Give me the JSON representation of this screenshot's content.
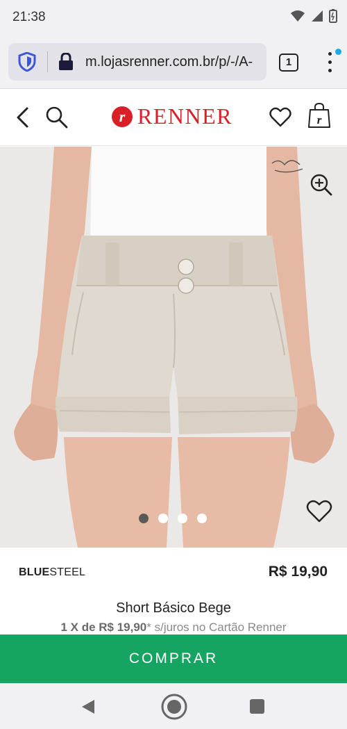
{
  "status_bar": {
    "time": "21:38",
    "icons": [
      "wifi-icon",
      "signal-icon",
      "battery-icon"
    ]
  },
  "browser": {
    "url": "m.lojasrenner.com.br/p/-/A-",
    "tab_count": "1"
  },
  "site_header": {
    "logo_text": "RENNER",
    "logo_mark": "r",
    "icons": [
      "back-arrow-icon",
      "search-icon",
      "wishlist-heart-icon",
      "shopping-bag-icon"
    ]
  },
  "gallery": {
    "image_alt": "Short Básico Bege",
    "slide_count": 4,
    "active_slide": 1
  },
  "product": {
    "brand_bold": "BLUE",
    "brand_light": "STEEL",
    "price": "R$ 19,90",
    "name": "Short Básico Bege",
    "installment_prefix": "1 X de ",
    "installment_value": "R$ 19,90",
    "installment_suffix": "* s/juros no Cartão Renner"
  },
  "actions": {
    "buy_label": "COMPRAR"
  },
  "colors": {
    "brand_red": "#d72027",
    "buy_green": "#16a462"
  }
}
